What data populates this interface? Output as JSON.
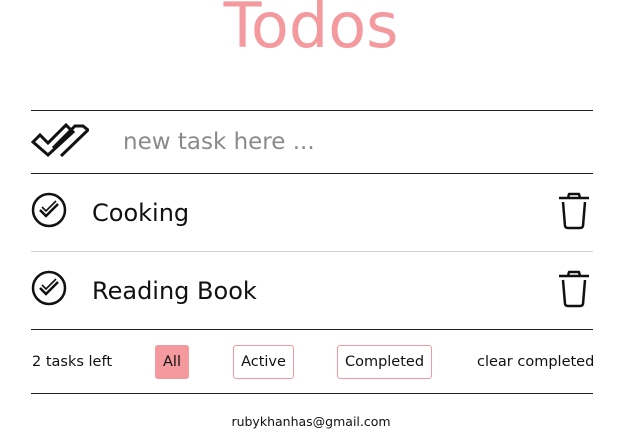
{
  "app": {
    "title": "Todos"
  },
  "new_task": {
    "placeholder": "new task here ...",
    "value": ""
  },
  "todos": [
    {
      "label": "Cooking",
      "completed": false
    },
    {
      "label": "Reading Book",
      "completed": false
    }
  ],
  "footer": {
    "count_text": "2 tasks left",
    "filters": [
      {
        "label": "All",
        "selected": true
      },
      {
        "label": "Active",
        "selected": false
      },
      {
        "label": "Completed",
        "selected": false
      }
    ],
    "clear_label": "clear completed"
  },
  "contact": {
    "email": "rubykhanhas@gmail.com"
  },
  "colors": {
    "accent": "#f49a9f",
    "filter_border": "#f19aa0",
    "text": "#111111",
    "placeholder": "#8a8a8a",
    "divider_dark": "#222222",
    "divider_light": "#cfcfcf"
  },
  "icons": {
    "toggle_all": "double-check-icon",
    "item_check": "circle-check-icon",
    "delete": "trash-icon"
  }
}
